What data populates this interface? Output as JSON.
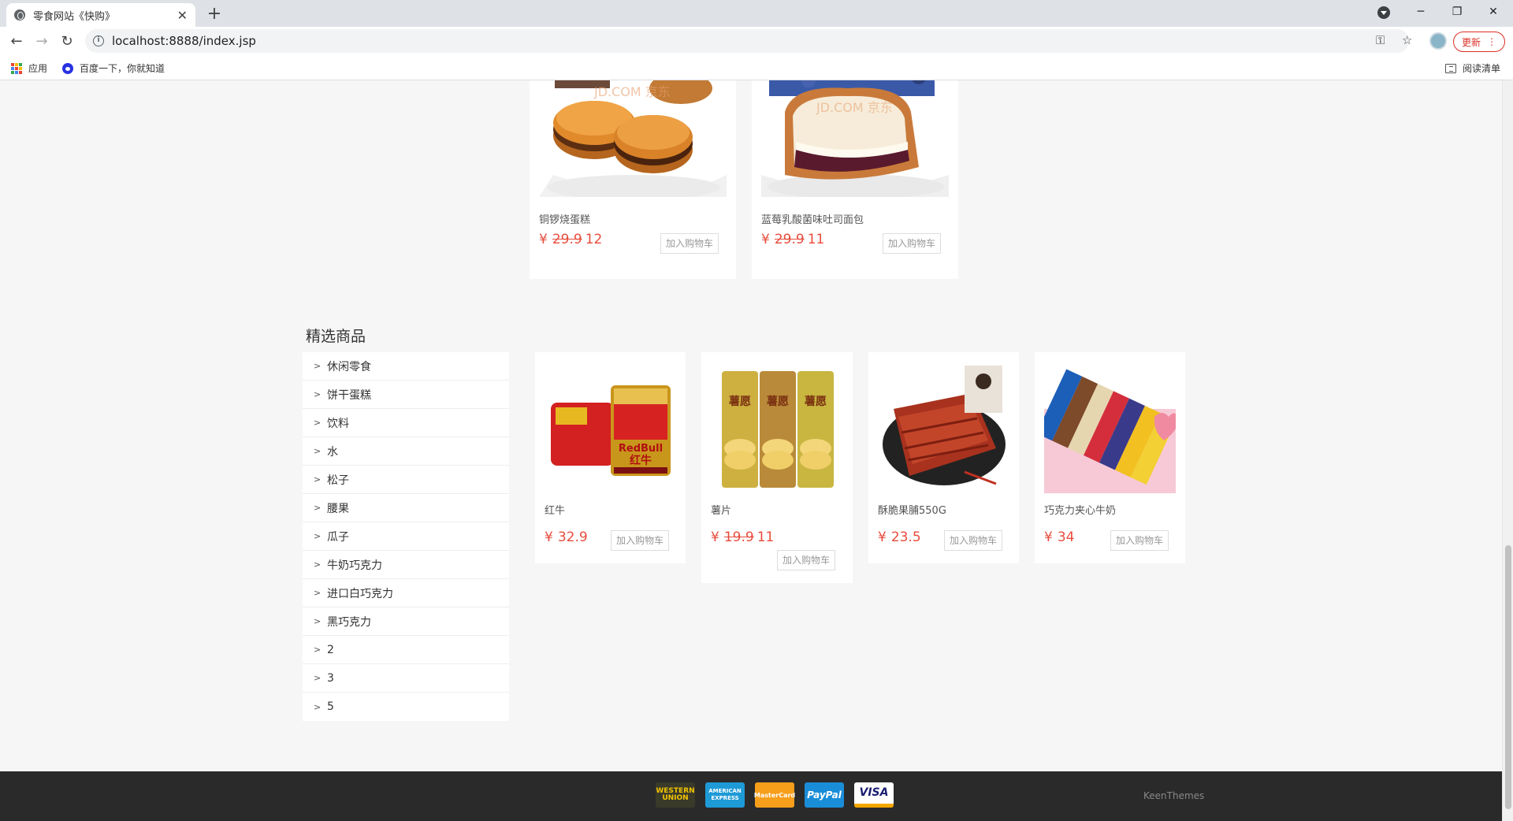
{
  "browser": {
    "tab_title": "零食网站《快购》",
    "tab_close": "✕",
    "new_tab": "+",
    "url": "localhost:8888/index.jsp",
    "update_label": "更新",
    "window_minimize": "─",
    "window_restore": "❐",
    "window_close": "✕",
    "bookmarks": [
      {
        "label": "应用",
        "icon": "apps-icon"
      },
      {
        "label": "百度一下，你就知道",
        "icon": "baidu-paw-icon"
      }
    ],
    "reading_list": "阅读清单"
  },
  "top_products": [
    {
      "name": "铜锣烧蛋糕",
      "currency": "¥",
      "old_price": "29.9",
      "price": "12",
      "add_label": "加入购物车",
      "image": "dorayaki-image"
    },
    {
      "name": "蓝莓乳酸菌味吐司面包",
      "currency": "¥",
      "old_price": "29.9",
      "price": "11",
      "add_label": "加入购物车",
      "image": "blueberry-toast-image"
    }
  ],
  "featured": {
    "title": "精选商品",
    "categories": [
      "休闲零食",
      "饼干蛋糕",
      "饮料",
      "水",
      "松子",
      "腰果",
      "瓜子",
      "牛奶巧克力",
      "进口白巧克力",
      "黑巧克力",
      "2",
      "3",
      "5"
    ],
    "products": [
      {
        "name": "红牛",
        "currency": "¥",
        "old_price": "",
        "price": "32.9",
        "add_label": "加入购物车",
        "image": "redbull-image"
      },
      {
        "name": "薯片",
        "currency": "¥",
        "old_price": "19.9",
        "price": "11",
        "add_label": "加入购物车",
        "image": "potato-chips-image"
      },
      {
        "name": "酥脆果脯550G",
        "currency": "¥",
        "old_price": "",
        "price": "23.5",
        "add_label": "加入购物车",
        "image": "dried-meat-image"
      },
      {
        "name": "巧克力夹心牛奶",
        "currency": "¥",
        "old_price": "",
        "price": "34",
        "add_label": "加入购物车",
        "image": "chocolate-bars-image"
      }
    ]
  },
  "image_text": {
    "watermark": "JD.COM 京东",
    "redbull_brand": "RedBull",
    "redbull_cn": "红牛",
    "chips_brand": "薯愿"
  },
  "footer": {
    "payments": [
      "WESTERN UNION",
      "AMERICAN EXPRESS",
      "MasterCard",
      "PayPal",
      "VISA"
    ],
    "brand": "KeenThemes"
  },
  "colors": {
    "price": "#e84c3d",
    "footer_bg": "#2a2a2a",
    "update": "#d93025"
  }
}
